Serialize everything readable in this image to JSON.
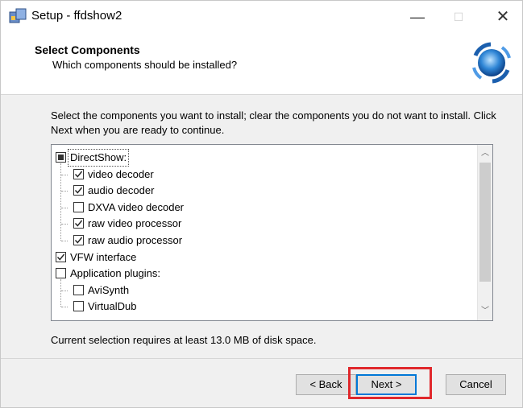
{
  "window": {
    "title": "Setup - ffdshow2"
  },
  "header": {
    "title": "Select Components",
    "subtitle": "Which components should be installed?"
  },
  "description": "Select the components you want to install; clear the components you do not want to install. Click Next when you are ready to continue.",
  "components": [
    {
      "label": "DirectShow:",
      "state": "partial",
      "level": 0,
      "focused": true
    },
    {
      "label": "video decoder",
      "state": "checked",
      "level": 1
    },
    {
      "label": "audio decoder",
      "state": "checked",
      "level": 1
    },
    {
      "label": "DXVA video decoder",
      "state": "unchecked",
      "level": 1
    },
    {
      "label": "raw video processor",
      "state": "checked",
      "level": 1
    },
    {
      "label": "raw audio processor",
      "state": "checked",
      "level": 1
    },
    {
      "label": "VFW interface",
      "state": "checked",
      "level": 0
    },
    {
      "label": "Application plugins:",
      "state": "unchecked",
      "level": 0
    },
    {
      "label": "AviSynth",
      "state": "unchecked",
      "level": 1
    },
    {
      "label": "VirtualDub",
      "state": "unchecked",
      "level": 1
    }
  ],
  "disk_space": "Current selection requires at least 13.0 MB of disk space.",
  "buttons": {
    "back": "< Back",
    "next": "Next >",
    "cancel": "Cancel"
  },
  "colors": {
    "highlight": "#e0282c",
    "focus_border": "#0078d7"
  }
}
